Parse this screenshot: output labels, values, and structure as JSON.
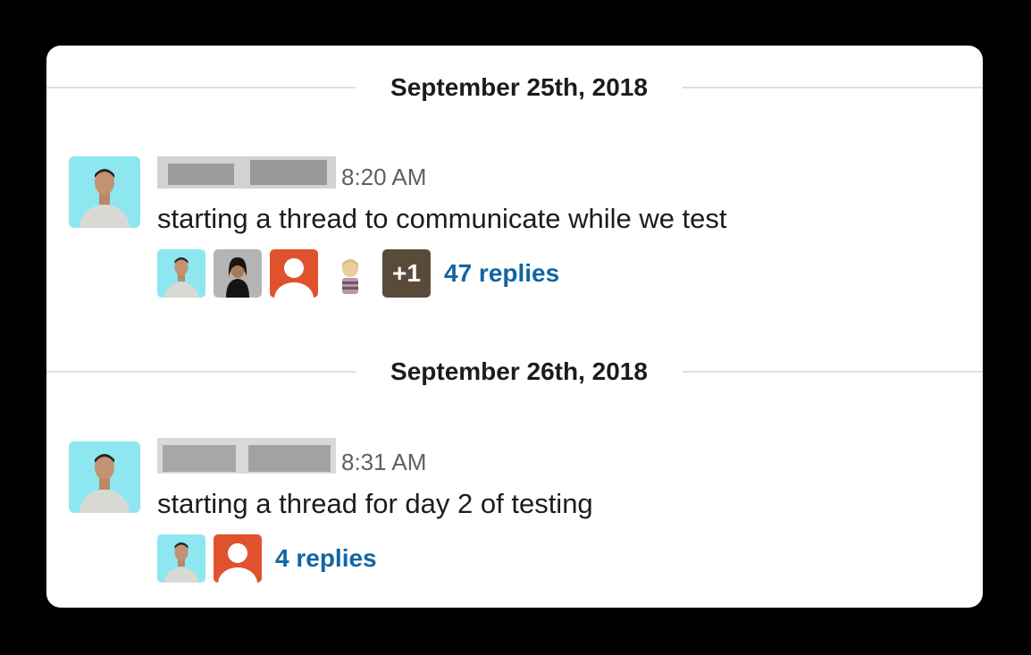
{
  "messages": [
    {
      "date": "September 25th, 2018",
      "time": "8:20 AM",
      "text": "starting a thread to communicate while we test",
      "more_badge": "+1",
      "replies": "47 replies"
    },
    {
      "date": "September 26th, 2018",
      "time": "8:31 AM",
      "text": "starting a thread for day 2 of testing",
      "replies": "4 replies"
    }
  ],
  "colors": {
    "link": "#1264a3",
    "divider": "#dedede",
    "avatar_bg": "#8ee6f0",
    "default_avatar": "#e0522e"
  },
  "icons": [
    "user-photo-avatar",
    "default-user-avatar-icon"
  ]
}
